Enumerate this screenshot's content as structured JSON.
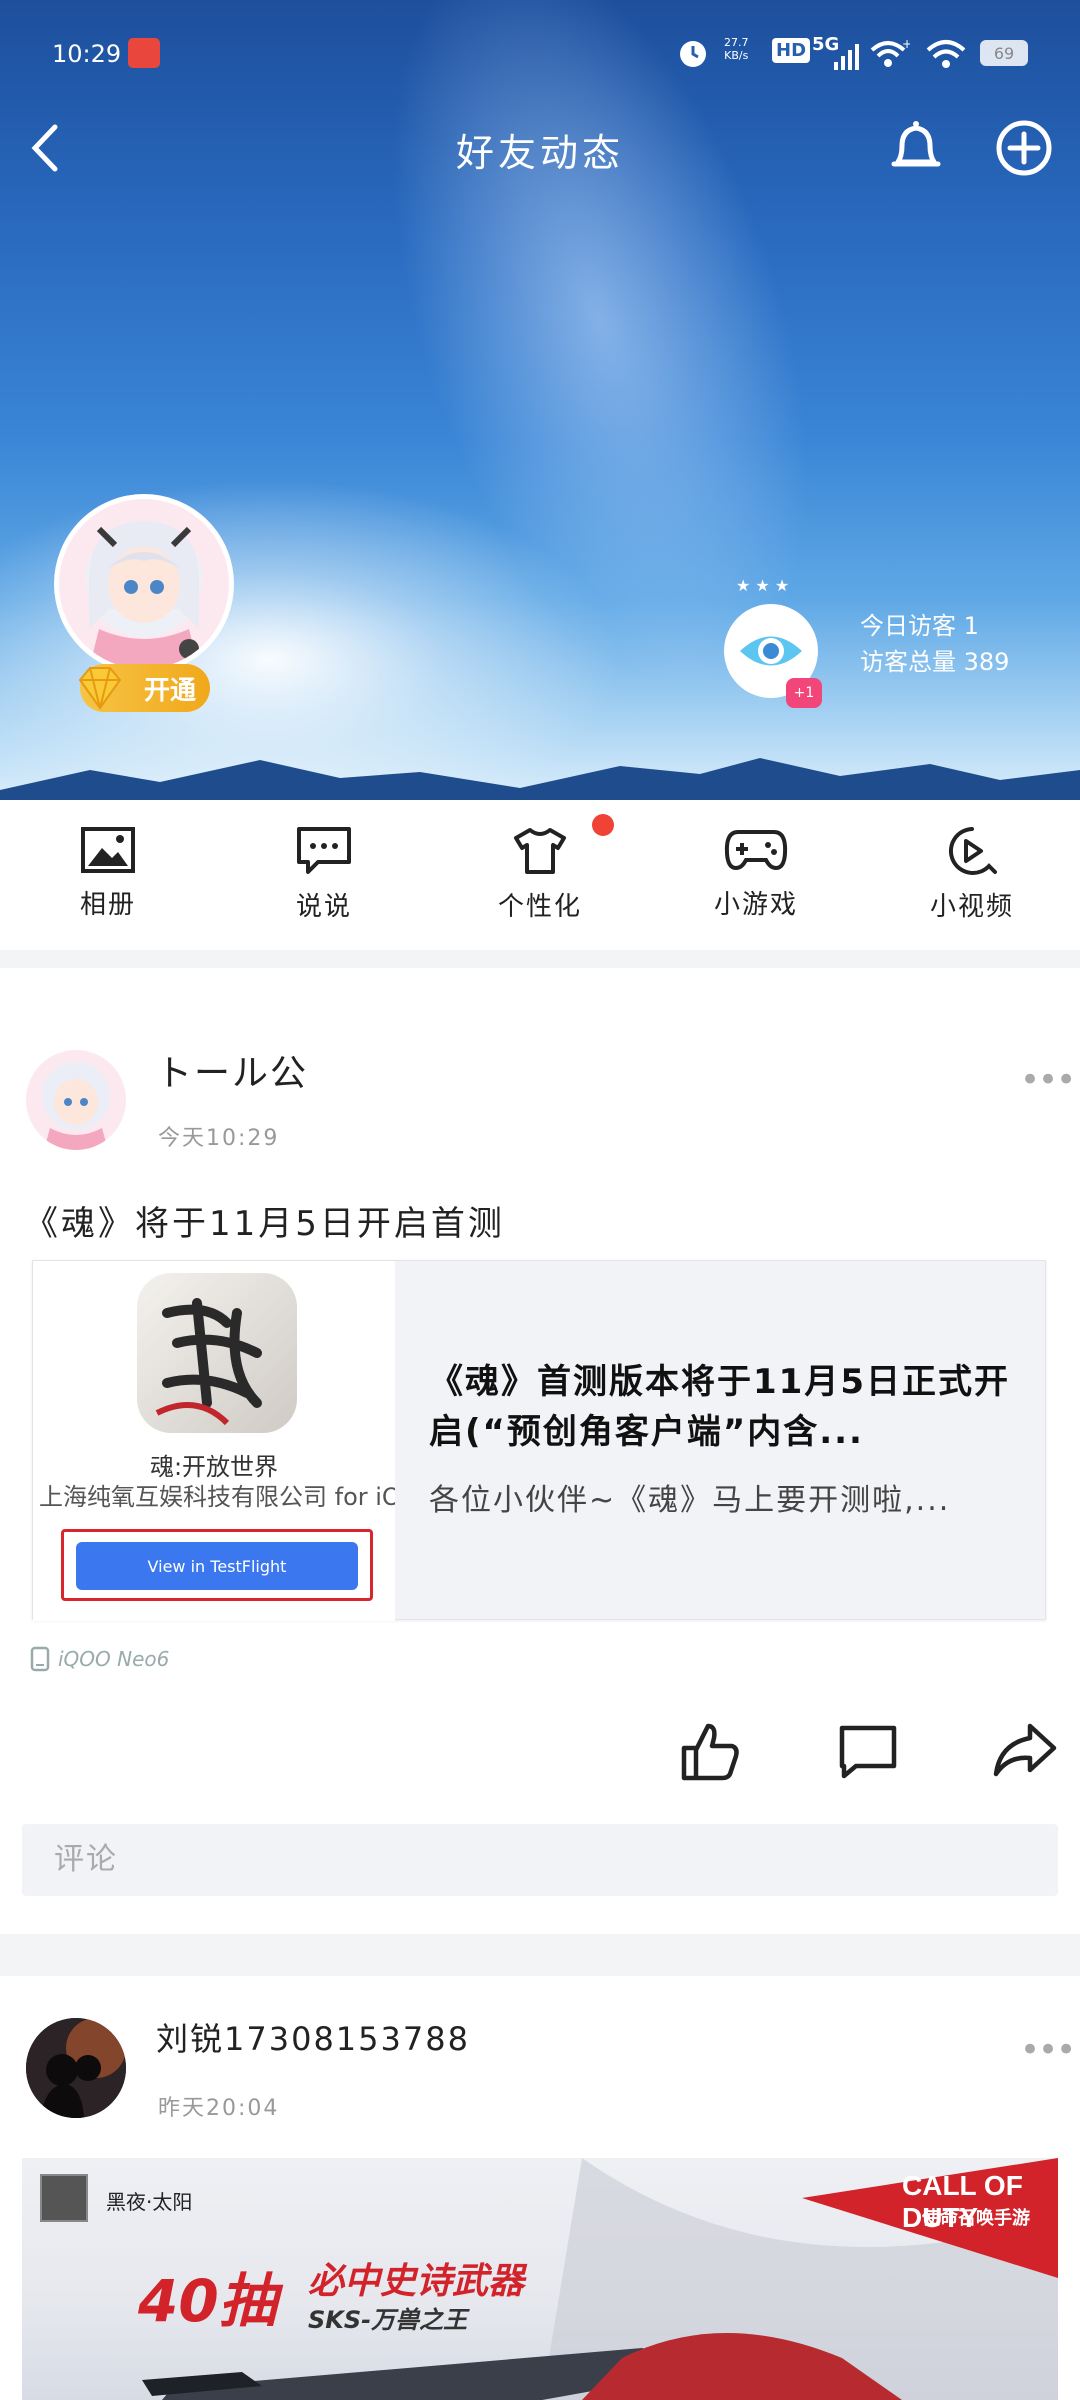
{
  "status_bar": {
    "time": "10:29",
    "net_speed_top": "27.7",
    "net_speed_unit": "KB/s",
    "hd": "HD",
    "network": "5G",
    "battery": "69"
  },
  "header": {
    "title": "好友动态",
    "vip_label": "开通",
    "visitors_today": "今日访客  1",
    "visitors_total": "访客总量 389",
    "eye_badge": "+1"
  },
  "nav": {
    "items": [
      {
        "label": "相册",
        "icon": "album-icon"
      },
      {
        "label": "说说",
        "icon": "chat-icon"
      },
      {
        "label": "个性化",
        "icon": "tshirt-icon"
      },
      {
        "label": "小游戏",
        "icon": "gamepad-icon"
      },
      {
        "label": "小视频",
        "icon": "video-icon"
      }
    ]
  },
  "posts": [
    {
      "author": "トール公",
      "time": "今天10:29",
      "text": "《魂》将于11月5日开启首测",
      "share": {
        "app_name": "魂:开放世界",
        "app_company": "上海纯氧互娱科技有限公司 for iOS",
        "button": "View in TestFlight",
        "title": "《魂》首测版本将于11月5日正式开启(“预创角客户端”内含...",
        "desc": "各位小伙伴~《魂》马上要开测啦,..."
      },
      "device": "iQOO Neo6",
      "comment_placeholder": "评论"
    },
    {
      "author": "刘锐17308153788",
      "time": "昨天20:04",
      "banner": {
        "channel": "黑夜·太阳",
        "headline": "40抽",
        "headline2": "必中史诗武器",
        "sub": "SKS-万兽之王",
        "brand": "CALL OF DUTY",
        "brand_sub": "使命召唤手游"
      }
    }
  ]
}
